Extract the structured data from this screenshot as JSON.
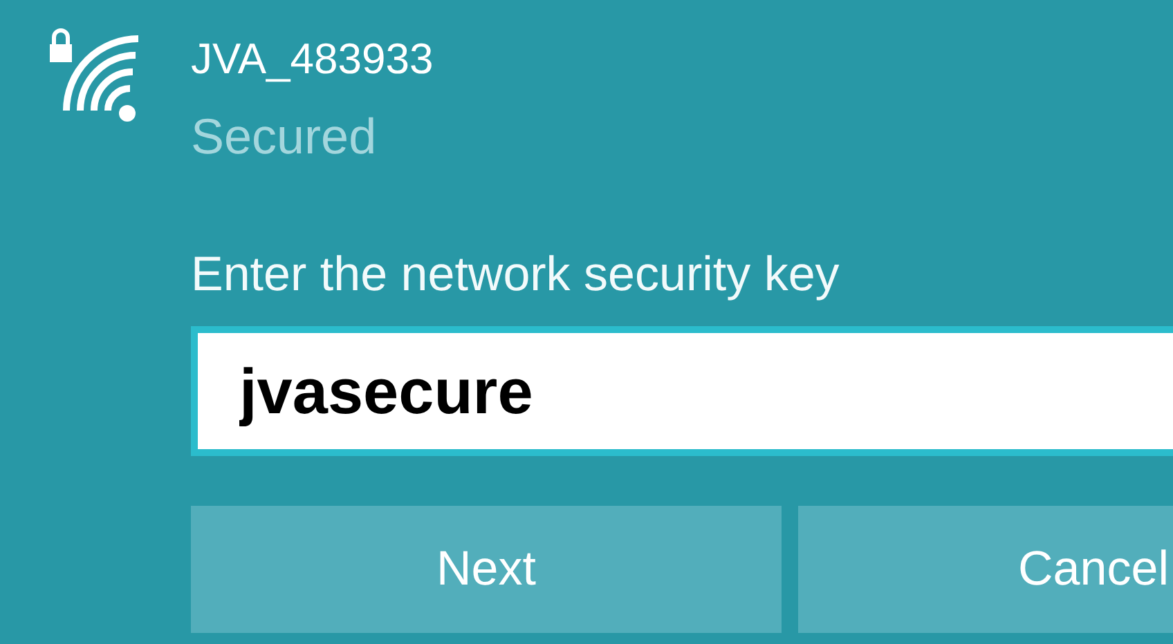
{
  "network": {
    "ssid": "JVA_483933",
    "status": "Secured"
  },
  "security_key": {
    "label": "Enter the network security key",
    "value": "jvasecure"
  },
  "buttons": [
    {
      "label": "Next"
    },
    {
      "label": "Cancel"
    }
  ]
}
